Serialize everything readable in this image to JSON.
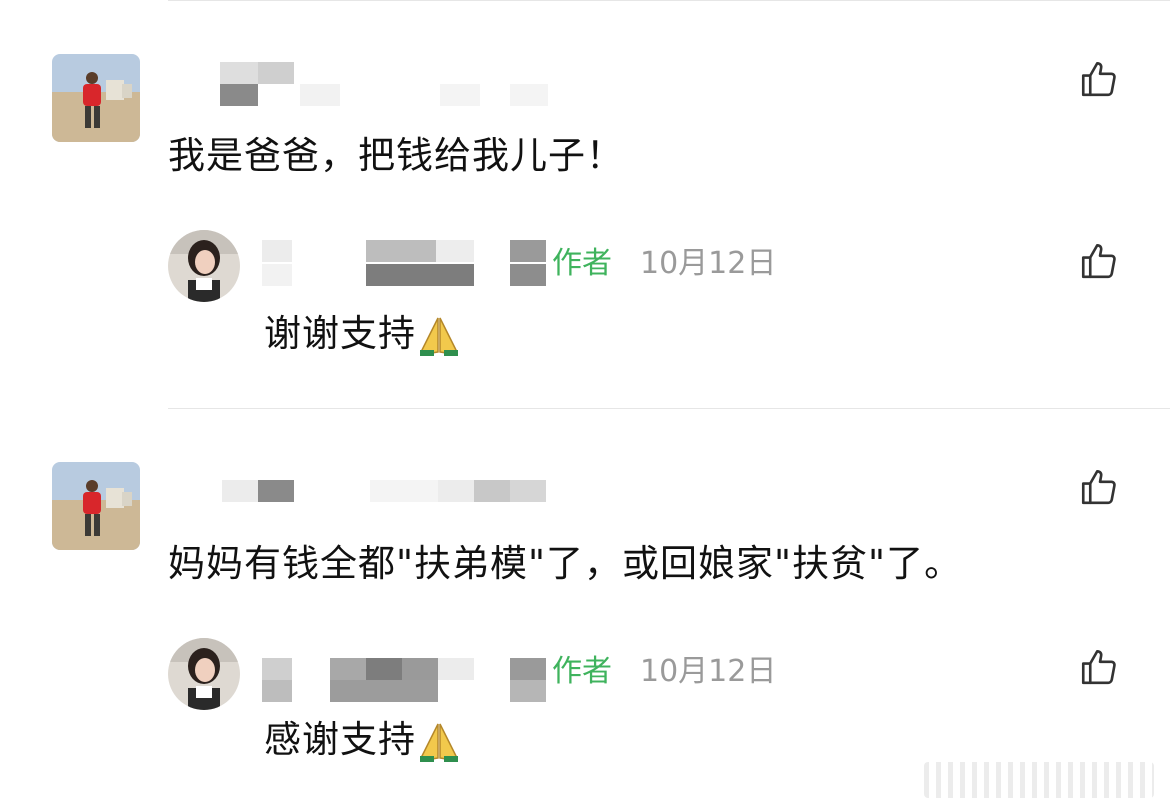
{
  "comments": [
    {
      "text": "我是爸爸，把钱给我儿子！",
      "reply": {
        "author_tag": "作者",
        "date": "10月12日",
        "text": "谢谢支持"
      }
    },
    {
      "text": "妈妈有钱全都\"扶弟模\"了，或回娘家\"扶贫\"了。",
      "reply": {
        "author_tag": "作者",
        "date": "10月12日",
        "text": "感谢支持"
      }
    }
  ],
  "icons": {
    "like": "thumbs-up-icon",
    "emoji": "folded-hands-emoji"
  },
  "colors": {
    "author_tag": "#3fb35d",
    "date": "#9a9a9a",
    "text": "#111111",
    "divider": "#e6e6e6"
  }
}
